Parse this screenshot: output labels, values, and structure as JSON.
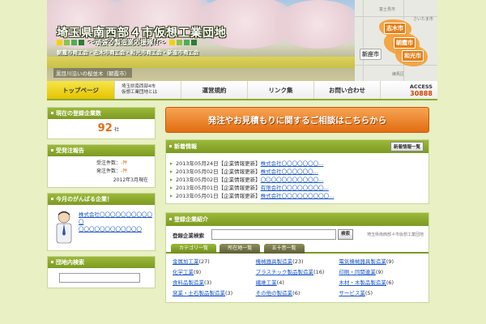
{
  "header": {
    "site_title": "埼玉県南西部４市仮想工業団地",
    "tagline": "～頑張る製造業応援隊!!～",
    "tagline_square_colors": [
      "#f0d400",
      "#8bc34a",
      "#4caf50",
      "#2e7d32"
    ],
    "chambers": "朝霞市商工会・志木市商工会・和光市商工会・新座市商工会",
    "photo_caption": "黒目川沿いの桜並木（朝霞市）",
    "map": {
      "highlight_color": "#f2a03a",
      "cities": [
        "志木市",
        "朝霞市",
        "新座市",
        "和光市"
      ],
      "bg_labels": [
        "富士見市",
        "練馬区",
        "さいたま市"
      ]
    }
  },
  "nav": {
    "items": [
      {
        "label": "トップページ",
        "active": true
      },
      {
        "label_line1": "埼玉県南西部4市",
        "label_line2": "仮想工業団地とは"
      },
      {
        "label": "運営規約"
      },
      {
        "label": "リンク集"
      },
      {
        "label": "お問い合わせ"
      }
    ],
    "access_label": "ACCESS",
    "access_count": "30888"
  },
  "sidebar": {
    "registered": {
      "title": "現在の登録企業数",
      "count": "92",
      "unit": "社"
    },
    "orders": {
      "title": "受発注報告",
      "rows": [
        {
          "label": "受注件数",
          "value": "-件"
        },
        {
          "label": "発注件数",
          "value": "-件"
        }
      ],
      "date": "2012年3月現在"
    },
    "featured": {
      "title": "今月のがんばる企業！",
      "company_line1": "株式会社〇〇〇〇〇〇〇〇〇〇〇",
      "company_line2": "〇〇〇〇〇〇〇〇〇〇〇〇"
    },
    "search": {
      "title": "団地内検索",
      "button": "検索"
    }
  },
  "main": {
    "banner": "発注やお見積もりに関するご相談はこちらから",
    "news": {
      "title": "新着情報",
      "list_button": "新着情報一覧",
      "items": [
        {
          "date": "2013年05月24日",
          "tag": "企業情報更新",
          "text": "株式会社〇〇〇〇〇〇〇..."
        },
        {
          "date": "2013年05月02日",
          "tag": "企業情報更新",
          "text": "株式会社〇〇〇〇〇〇..."
        },
        {
          "date": "2013年05月02日",
          "tag": "企業情報更新",
          "text": "〇〇〇〇〇〇〇〇〇〇〇..."
        },
        {
          "date": "2013年05月01日",
          "tag": "企業情報更新",
          "text": "有限会社〇〇〇〇〇〇〇〇..."
        },
        {
          "date": "2013年05月01日",
          "tag": "企業情報更新",
          "text": "株式会社〇〇〇〇〇〇〇〇〇..."
        }
      ]
    },
    "companies": {
      "title": "登録企業紹介",
      "search_label": "登録企業検索",
      "search_button": "検索",
      "note": "埼玉県南西部４市仮想工業団地",
      "tabs": [
        "カテゴリ一覧",
        "所在地一覧",
        "五十音一覧"
      ],
      "categories": [
        {
          "name": "金属加工業",
          "count": "(27)"
        },
        {
          "name": "機械器具製造業",
          "count": "(23)"
        },
        {
          "name": "電気機械器具製造業",
          "count": "(9)"
        },
        {
          "name": "化学工業",
          "count": "(9)"
        },
        {
          "name": "プラスチック製品製造業",
          "count": "(16)"
        },
        {
          "name": "印刷・同関連業",
          "count": "(9)"
        },
        {
          "name": "食料品製造業",
          "count": "(3)"
        },
        {
          "name": "繊維工業",
          "count": "(4)"
        },
        {
          "name": "木材・木製品製造業",
          "count": "(6)"
        },
        {
          "name": "窯業・土石製品製造業",
          "count": "(3)"
        },
        {
          "name": "その他の製造業",
          "count": "(6)"
        },
        {
          "name": "サービス業",
          "count": "(5)"
        }
      ]
    }
  }
}
